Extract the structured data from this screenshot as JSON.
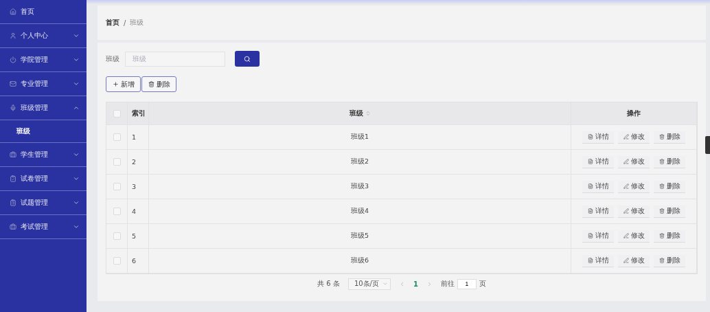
{
  "sidebar": {
    "items": [
      {
        "label": "首页"
      },
      {
        "label": "个人中心",
        "expanded": false
      },
      {
        "label": "学院管理",
        "expanded": false
      },
      {
        "label": "专业管理",
        "expanded": false
      },
      {
        "label": "班级管理",
        "expanded": true,
        "children": [
          {
            "label": "班级",
            "selected": true
          }
        ]
      },
      {
        "label": "学生管理",
        "expanded": false
      },
      {
        "label": "试卷管理",
        "expanded": false
      },
      {
        "label": "试题管理",
        "expanded": false
      },
      {
        "label": "考试管理",
        "expanded": false
      }
    ]
  },
  "breadcrumb": {
    "items": [
      "首页",
      "班级"
    ],
    "separator": "/"
  },
  "search": {
    "label": "班级",
    "placeholder": "班级"
  },
  "actions": [
    "新增",
    "删除"
  ],
  "table": {
    "header_checked": false,
    "columns": [
      "索引",
      "班级",
      "操作"
    ],
    "rows": [
      {
        "checked": false,
        "index": "1",
        "name": "班级1",
        "actions": [
          "详情",
          "修改",
          "删除"
        ]
      },
      {
        "checked": false,
        "index": "2",
        "name": "班级2",
        "actions": [
          "详情",
          "修改",
          "删除"
        ]
      },
      {
        "checked": false,
        "index": "3",
        "name": "班级3",
        "actions": [
          "详情",
          "修改",
          "删除"
        ]
      },
      {
        "checked": false,
        "index": "4",
        "name": "班级4",
        "actions": [
          "详情",
          "修改",
          "删除"
        ]
      },
      {
        "checked": false,
        "index": "5",
        "name": "班级5",
        "actions": [
          "详情",
          "修改",
          "删除"
        ]
      },
      {
        "checked": false,
        "index": "6",
        "name": "班级6",
        "actions": [
          "详情",
          "修改",
          "删除"
        ]
      }
    ]
  },
  "pagination": {
    "total": "共 6 条",
    "page_size": "10条/页",
    "pages": [
      {
        "label": "1",
        "selected": true
      }
    ],
    "goto_label": "前往",
    "goto_value": "1",
    "goto_suffix": "页"
  }
}
